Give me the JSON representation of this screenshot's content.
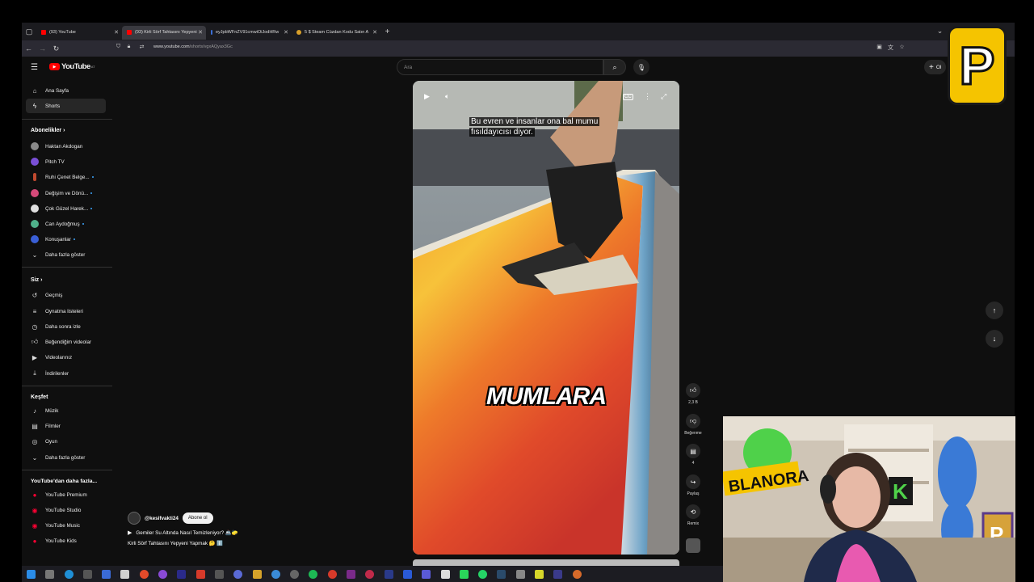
{
  "browser": {
    "tabs": [
      {
        "label": "(93) YouTube",
        "active": false
      },
      {
        "label": "(93) Kirli Sörf Tahtasını Yepyeni",
        "active": true
      },
      {
        "label": "eyJpbWFnZV91cmwiOiJodHRw",
        "active": false
      },
      {
        "label": "5 $ Steam Cüzdan Kodu Satın A",
        "active": false
      }
    ],
    "new_tab_label": "+",
    "url_domain": "www.youtube.com",
    "url_path": "/shorts/vgxAQyax3Gc"
  },
  "youtube": {
    "logo_text": "YouTube",
    "logo_country": "AT",
    "search_placeholder": "Ara",
    "create_label": "Ol",
    "nav": [
      {
        "label": "Ana Sayfa",
        "icon": "home-icon"
      },
      {
        "label": "Shorts",
        "icon": "shorts-icon"
      }
    ],
    "subscriptions_title": "Abonelikler",
    "subscriptions": [
      {
        "label": "Haktan Akdogan",
        "color": "#8a8a8a",
        "new": false
      },
      {
        "label": "Pitch TV",
        "color": "#7a4fd6",
        "new": false
      },
      {
        "label": "Ruhi Çenet Belge...",
        "color": "#c04a2f",
        "new": true
      },
      {
        "label": "Değişim ve Dönü...",
        "color": "#d64a7a",
        "new": true
      },
      {
        "label": "Çok Güzel Harek...",
        "color": "#e0e0e0",
        "new": true
      },
      {
        "label": "Can Aydoğmuş",
        "color": "#4fb08a",
        "new": true
      },
      {
        "label": "Konuşanlar",
        "color": "#3a5fd6",
        "new": true
      }
    ],
    "show_more": "Daha fazla göster",
    "you_title": "Siz",
    "you_items": [
      {
        "label": "Geçmiş",
        "icon": "history-icon"
      },
      {
        "label": "Oynatma listeleri",
        "icon": "playlists-icon"
      },
      {
        "label": "Daha sonra izle",
        "icon": "watch-later-icon"
      },
      {
        "label": "Beğendiğim videolar",
        "icon": "liked-icon"
      },
      {
        "label": "Videolarınız",
        "icon": "your-videos-icon"
      },
      {
        "label": "İndirilenler",
        "icon": "downloads-icon"
      }
    ],
    "explore_title": "Keşfet",
    "explore_items": [
      {
        "label": "Müzik",
        "icon": "music-icon"
      },
      {
        "label": "Filmler",
        "icon": "movies-icon"
      },
      {
        "label": "Oyun",
        "icon": "gaming-icon"
      }
    ],
    "explore_more": "Daha fazla göster",
    "more_title": "YouTube'dan daha fazla...",
    "more_items": [
      {
        "label": "YouTube Premium"
      },
      {
        "label": "YouTube Studio"
      },
      {
        "label": "YouTube Music"
      },
      {
        "label": "YouTube Kids"
      }
    ]
  },
  "short": {
    "caption_line1": "Bu evren ve insanlar ona bal mumu",
    "caption_line2": "fısıldayıcısı diyor.",
    "overlay_word": "MUMLARA",
    "likes": "2,3 B",
    "dislike_label": "Beğenme",
    "comments": "4",
    "share_label": "Paylaş",
    "remix_label": "Remix",
    "channel": "@kesifvakti24",
    "subscribe": "Abone ol",
    "related": "Gemiler Su Altında Nasıl Temizleniyor? 🚢🧽",
    "title": "Kirli Sörf Tahtasını Yepyeni Yapmak 🤔 ℹ️",
    "play_state": "playing"
  },
  "overlays": {
    "streamer_logo_letter": "P",
    "webcam_sign": "BLANORA"
  }
}
